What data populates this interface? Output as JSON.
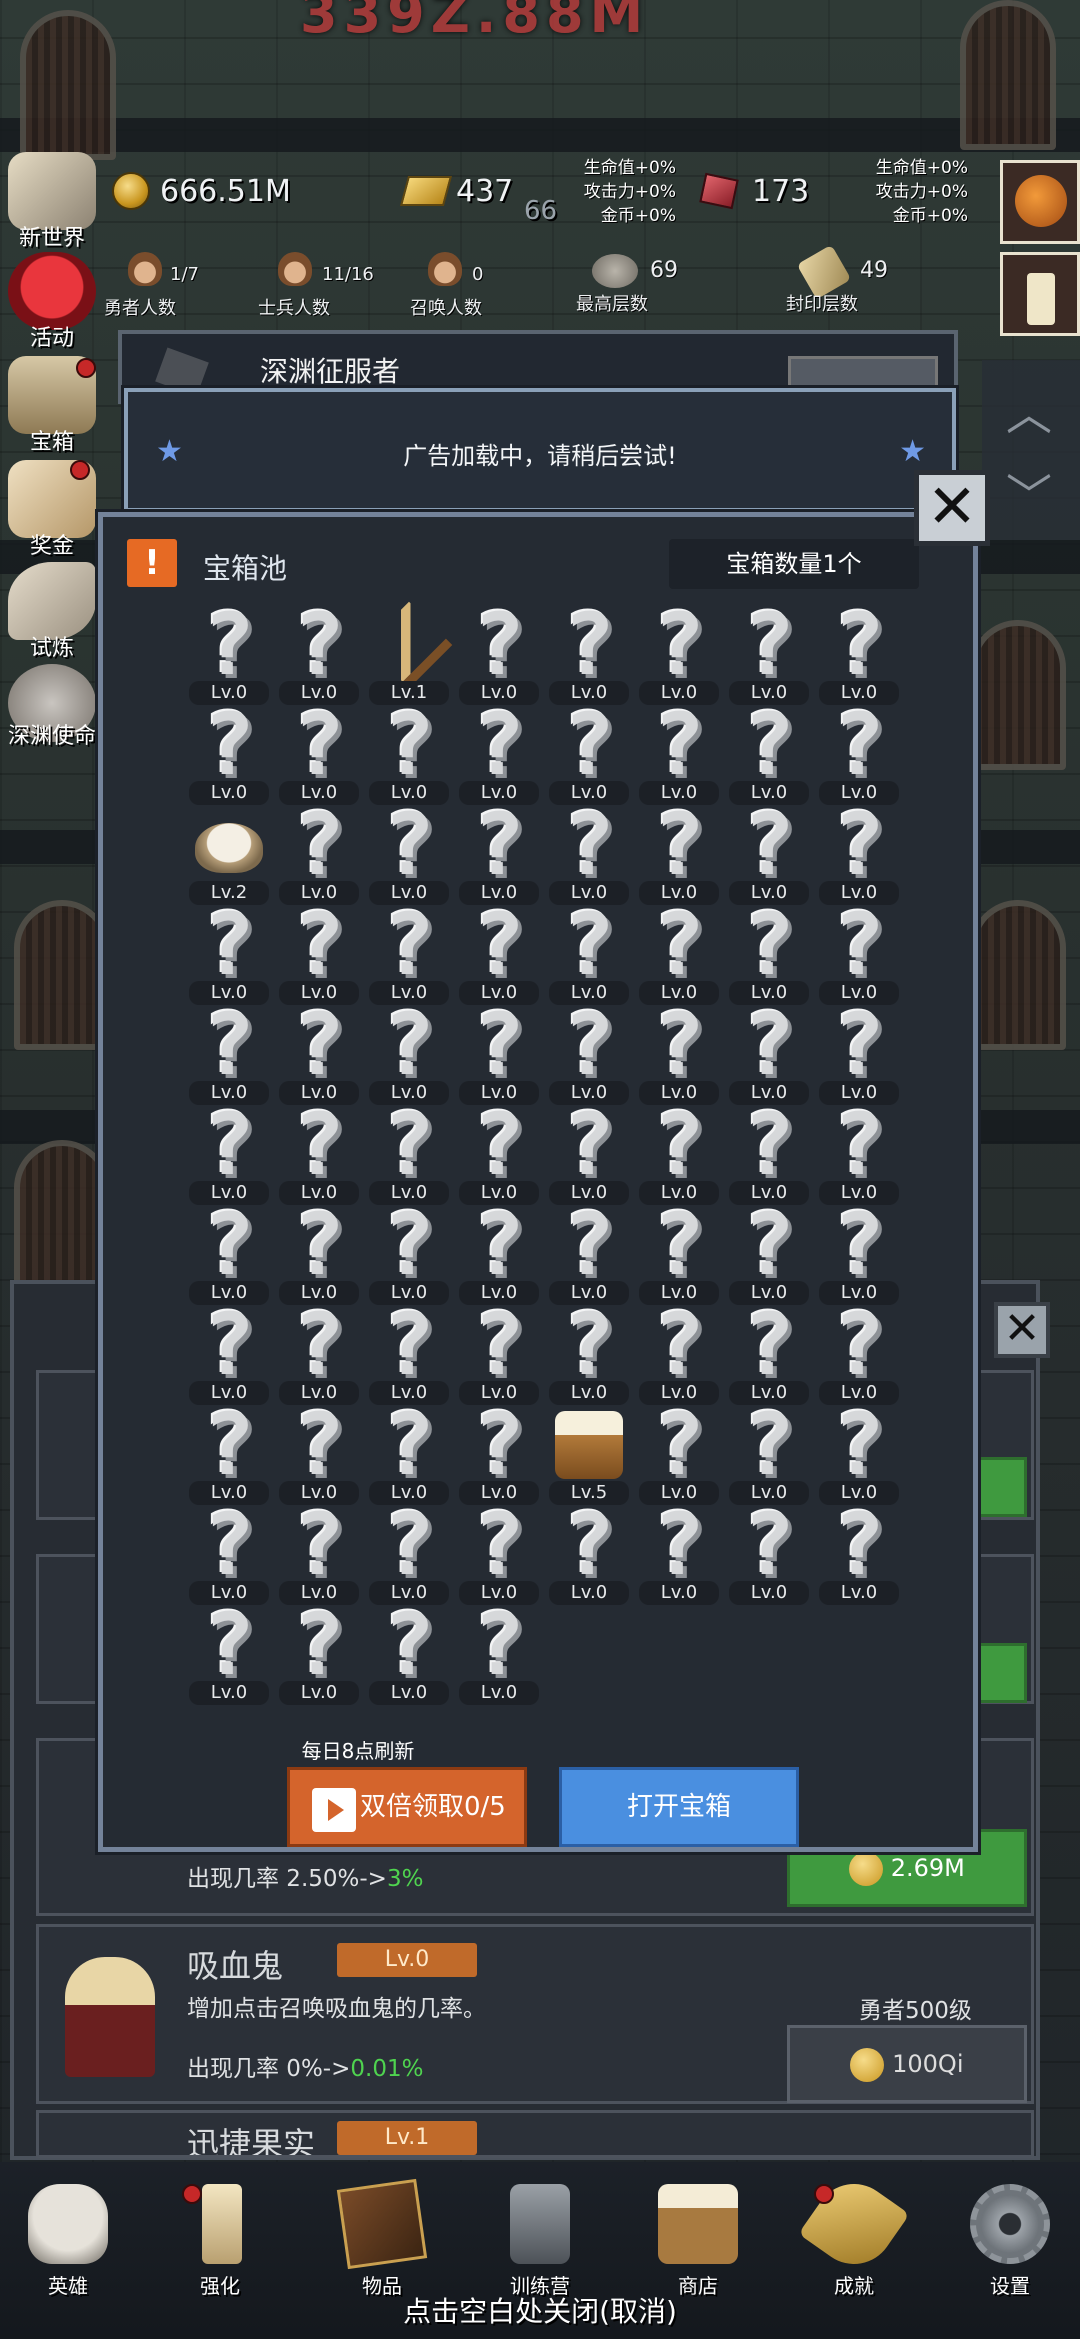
{
  "hud": {
    "gold": "666.51M",
    "gold_bars": "437",
    "gems": "173",
    "floor_mid": "66",
    "left_bonus": [
      "生命值+0%",
      "攻击力+0%",
      "金币+0%"
    ],
    "right_bonus": [
      "生命值+0%",
      "攻击力+0%",
      "金币+0%"
    ],
    "stats": [
      {
        "value": "1/7",
        "label": "勇者人数"
      },
      {
        "value": "11/16",
        "label": "士兵人数"
      },
      {
        "value": "0",
        "label": "召唤人数"
      },
      {
        "value": "69",
        "label": "最高层数"
      },
      {
        "value": "49",
        "label": "封印层数"
      }
    ]
  },
  "side_menu": [
    "新世界",
    "活动",
    "宝箱",
    "奖金",
    "试炼",
    "深渊使命"
  ],
  "header_behind": {
    "title": "深渊征服者"
  },
  "toast": {
    "text": "广告加载中，请稍后尝试!"
  },
  "modal": {
    "title": "宝箱池",
    "count": "宝箱数量1个",
    "daily_refresh": "每日8点刷新",
    "double_button": "双倍领取0/5",
    "open_button": "打开宝箱",
    "items": [
      "Lv.0",
      "Lv.0",
      "Lv.1",
      "Lv.0",
      "Lv.0",
      "Lv.0",
      "Lv.0",
      "Lv.0",
      "Lv.0",
      "Lv.0",
      "Lv.0",
      "Lv.0",
      "Lv.0",
      "Lv.0",
      "Lv.0",
      "Lv.0",
      "Lv.2",
      "Lv.0",
      "Lv.0",
      "Lv.0",
      "Lv.0",
      "Lv.0",
      "Lv.0",
      "Lv.0",
      "Lv.0",
      "Lv.0",
      "Lv.0",
      "Lv.0",
      "Lv.0",
      "Lv.0",
      "Lv.0",
      "Lv.0",
      "Lv.0",
      "Lv.0",
      "Lv.0",
      "Lv.0",
      "Lv.0",
      "Lv.0",
      "Lv.0",
      "Lv.0",
      "Lv.0",
      "Lv.0",
      "Lv.0",
      "Lv.0",
      "Lv.0",
      "Lv.0",
      "Lv.0",
      "Lv.0",
      "Lv.0",
      "Lv.0",
      "Lv.0",
      "Lv.0",
      "Lv.0",
      "Lv.0",
      "Lv.0",
      "Lv.0",
      "Lv.0",
      "Lv.0",
      "Lv.0",
      "Lv.0",
      "Lv.0",
      "Lv.0",
      "Lv.0",
      "Lv.0",
      "Lv.0",
      "Lv.0",
      "Lv.0",
      "Lv.0",
      "Lv.5",
      "Lv.0",
      "Lv.0",
      "Lv.0",
      "Lv.0",
      "Lv.0",
      "Lv.0",
      "Lv.0",
      "Lv.0",
      "Lv.0",
      "Lv.0",
      "Lv.0",
      "Lv.0",
      "Lv.0",
      "Lv.0",
      "Lv.0"
    ],
    "item_icons": {
      "2": "sword-icon",
      "16": "rice-bowl-icon",
      "68": "beer-mug-icon"
    }
  },
  "lower_panel": {
    "card3": {
      "rate": "出现几率 2.50%->",
      "rate_new": "3%",
      "price": "2.69M"
    },
    "vampire": {
      "name": "吸血鬼",
      "level": "Lv.0",
      "desc": "增加点击召唤吸血鬼的几率。",
      "rate": "出现几率 0%->",
      "rate_new": "0.01%",
      "req": "勇者500级",
      "price": "100Qi"
    },
    "fruit": {
      "name": "迅捷果实",
      "level": "Lv.1"
    }
  },
  "bottom_nav": [
    "英雄",
    "强化",
    "物品",
    "训练营",
    "商店",
    "成就",
    "设置"
  ],
  "close_hint": "点击空白处关闭(取消)"
}
